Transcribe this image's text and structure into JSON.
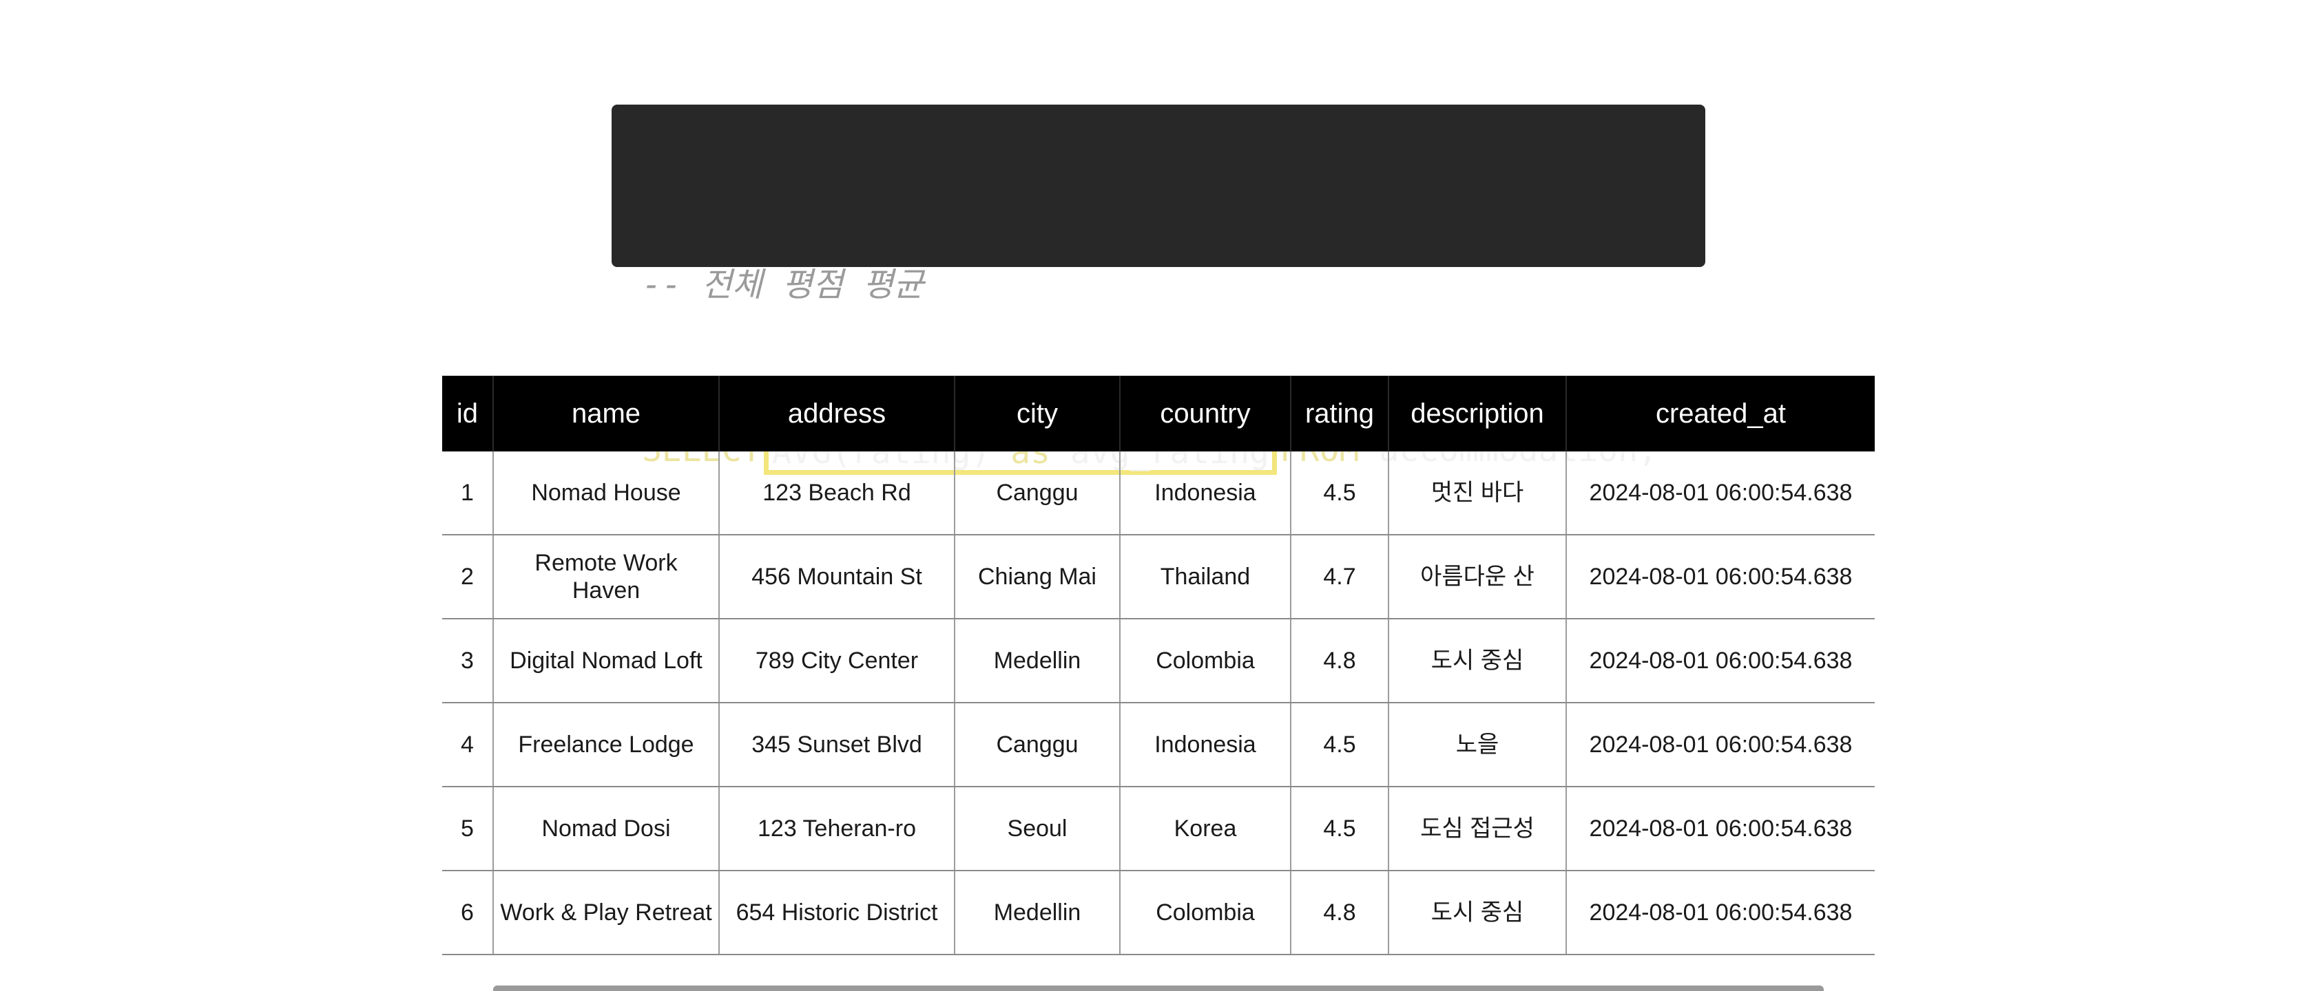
{
  "code": {
    "comment": "-- 전체 평점 평균",
    "keyword_select": "SELECT",
    "fn_call": "AVG(rating)",
    "keyword_as": "as",
    "alias": "avg_rating",
    "keyword_from": "FROM",
    "table_name": "accommodation;"
  },
  "table": {
    "headers": [
      "id",
      "name",
      "address",
      "city",
      "country",
      "rating",
      "description",
      "created_at"
    ],
    "rows": [
      [
        "1",
        "Nomad House",
        "123 Beach Rd",
        "Canggu",
        "Indonesia",
        "4.5",
        "멋진 바다",
        "2024-08-01 06:00:54.638"
      ],
      [
        "2",
        "Remote Work Haven",
        "456 Mountain St",
        "Chiang Mai",
        "Thailand",
        "4.7",
        "아름다운 산",
        "2024-08-01 06:00:54.638"
      ],
      [
        "3",
        "Digital Nomad Loft",
        "789 City Center",
        "Medellin",
        "Colombia",
        "4.8",
        "도시 중심",
        "2024-08-01 06:00:54.638"
      ],
      [
        "4",
        "Freelance Lodge",
        "345 Sunset Blvd",
        "Canggu",
        "Indonesia",
        "4.5",
        "노을",
        "2024-08-01 06:00:54.638"
      ],
      [
        "5",
        "Nomad Dosi",
        "123 Teheran-ro",
        "Seoul",
        "Korea",
        "4.5",
        "도심 접근성",
        "2024-08-01 06:00:54.638"
      ],
      [
        "6",
        "Work & Play Retreat",
        "654 Historic District",
        "Medellin",
        "Colombia",
        "4.8",
        "도시 중심",
        "2024-08-01 06:00:54.638"
      ]
    ]
  },
  "colors": {
    "code_background": "#282828",
    "highlight_border": "#f2e67c",
    "keyword": "#ece5a2",
    "header_background": "#000000"
  }
}
